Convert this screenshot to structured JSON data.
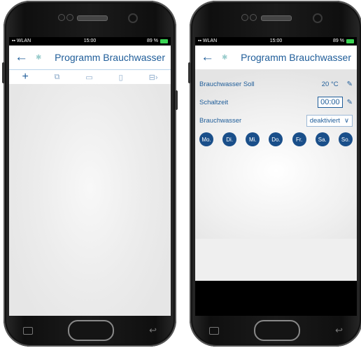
{
  "left": {
    "status": {
      "network": "▪▪ WLAN",
      "time": "15:00",
      "battery": "89 %"
    },
    "appbar": {
      "title": "Programm Brauchwasser"
    },
    "toolbar": {
      "icons": [
        "add-icon",
        "copy-icon",
        "paste-icon",
        "delete-icon",
        "edit-icon"
      ]
    }
  },
  "right": {
    "status": {
      "network": "▪▪ WLAN",
      "time": "15:00",
      "battery": "89 %"
    },
    "appbar": {
      "title": "Programm Brauchwasser"
    },
    "rows": {
      "soll_label": "Brauchwasser Soll",
      "soll_value": "20 °C",
      "schaltzeit_label": "Schaltzeit",
      "schaltzeit_value": "00:00",
      "mode_label": "Brauchwasser",
      "mode_value": "deaktiviert"
    },
    "days": [
      "Mo.",
      "Di.",
      "Mi.",
      "Do.",
      "Fr.",
      "Sa.",
      "So."
    ]
  },
  "colors": {
    "accent": "#1f5d99",
    "day_fill": "#1a4f8a"
  }
}
